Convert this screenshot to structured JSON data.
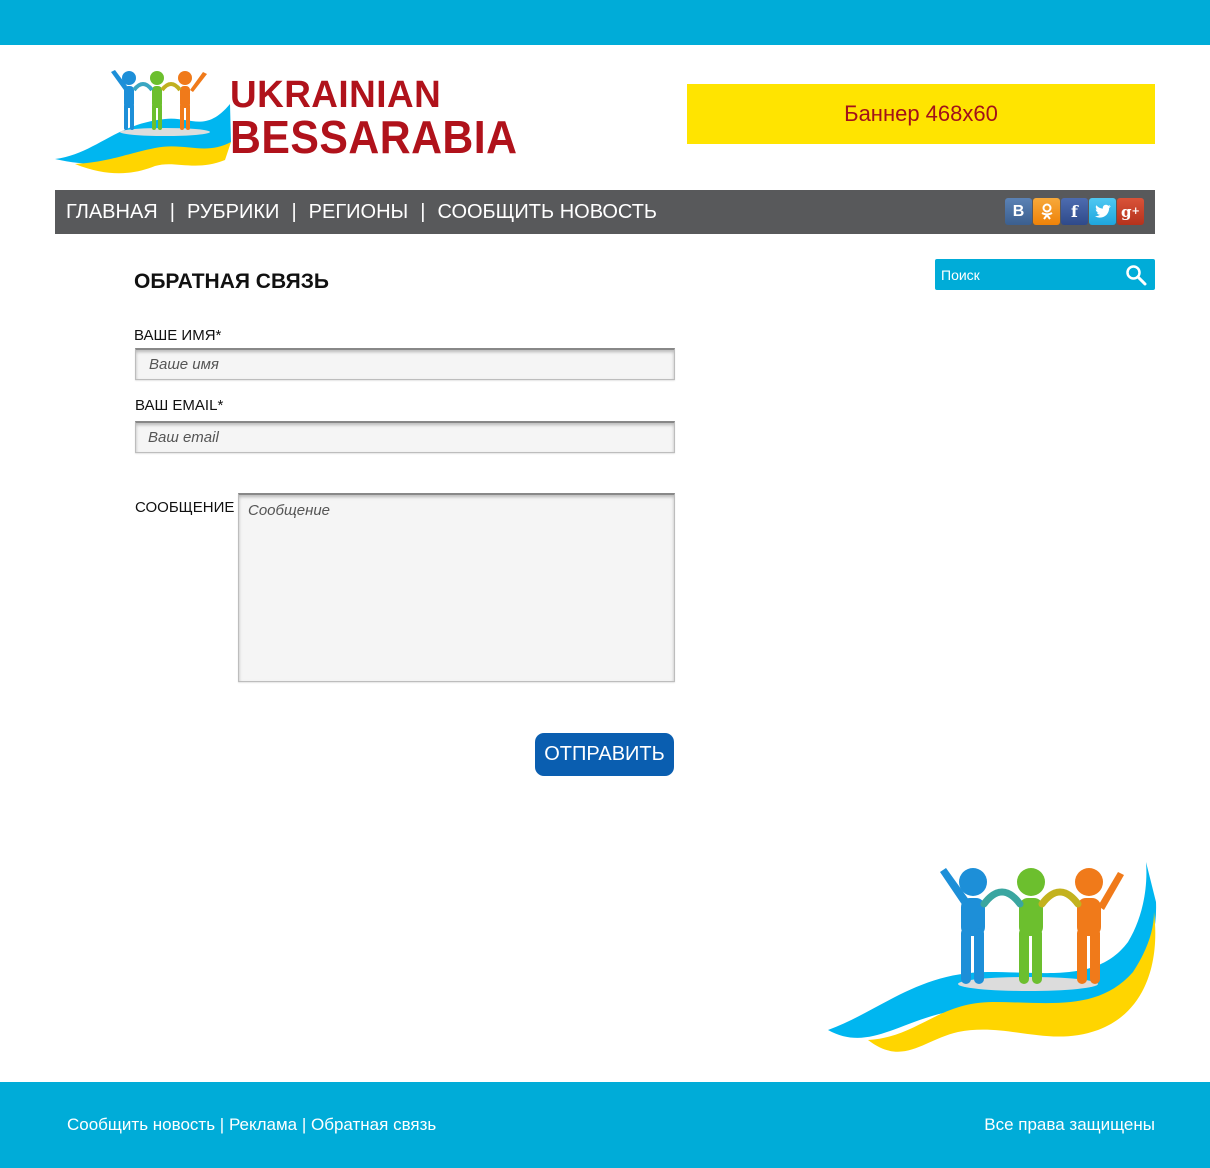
{
  "logo": {
    "line1": "UKRAINIAN",
    "line2": "BESSARABIA",
    "colors": {
      "text": "#b0121b",
      "blue": "#00b6f0",
      "yellow": "#ffd500"
    }
  },
  "banner": {
    "label": "Баннер 468x60",
    "background": "#ffe400",
    "text_color": "#a2121a"
  },
  "nav": {
    "items": [
      "ГЛАВНАЯ",
      "РУБРИКИ",
      "РЕГИОНЫ",
      "СООБЩИТЬ НОВОСТЬ"
    ],
    "separator": "|",
    "background": "#58595b"
  },
  "socials": [
    {
      "name": "vk-icon",
      "glyph": "В"
    },
    {
      "name": "odnoklassniki-icon",
      "glyph": "ok"
    },
    {
      "name": "facebook-icon",
      "glyph": "f"
    },
    {
      "name": "twitter-icon",
      "glyph": "bird"
    },
    {
      "name": "google-plus-icon",
      "glyph": "g+"
    }
  ],
  "search": {
    "placeholder": "Поиск",
    "icon": "search-icon"
  },
  "form": {
    "title": "ОБРАТНАЯ СВЯЗЬ",
    "name_label": "ВАШЕ ИМЯ*",
    "name_placeholder": "Ваше имя",
    "email_label": "ВАШ  EMAIL*",
    "email_placeholder": "Ваш email",
    "message_label": "СООБЩЕНИЕ",
    "message_placeholder": "Сообщение",
    "submit_label": "ОТПРАВИТЬ"
  },
  "footer": {
    "links": [
      "Сообщить новость",
      "Реклама",
      "Обратная связь"
    ],
    "separator": " | ",
    "copyright": "Все права защищены"
  },
  "colors": {
    "accent": "#00acd8",
    "button": "#0a5eb0"
  }
}
